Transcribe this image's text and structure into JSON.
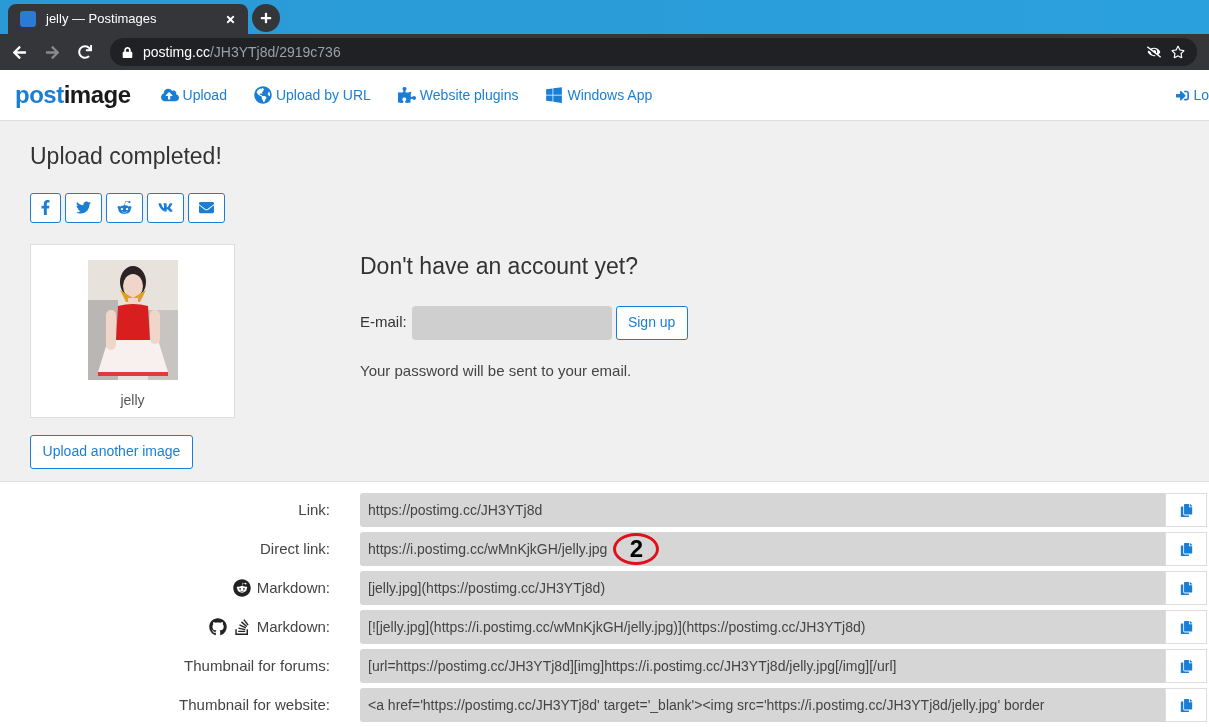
{
  "browser": {
    "tab": {
      "title": "jelly — Postimages"
    },
    "address": {
      "host": "postimg.cc",
      "path": "/JH3YTj8d/2919c736"
    }
  },
  "nav": {
    "logo": "postimage",
    "items": [
      {
        "kind": "upload",
        "label": "Upload"
      },
      {
        "kind": "url",
        "label": "Upload by URL"
      },
      {
        "kind": "plugins",
        "label": "Website plugins"
      },
      {
        "kind": "windows",
        "label": "Windows App"
      }
    ],
    "login": "Lo"
  },
  "upload": {
    "title": "Upload completed!",
    "share": [
      {
        "kind": "facebook"
      },
      {
        "kind": "twitter"
      },
      {
        "kind": "reddit"
      },
      {
        "kind": "vk"
      },
      {
        "kind": "email"
      }
    ],
    "thumbnail": {
      "kind": "picture",
      "caption": "jelly"
    },
    "another": "Upload another image"
  },
  "signup": {
    "title": "Don't have an account yet?",
    "email_label": "E-mail:",
    "button": "Sign up",
    "note": "Your password will be sent to your email."
  },
  "links": [
    {
      "label": "Link:",
      "value": "https://postimg.cc/JH3YTj8d"
    },
    {
      "label": "Direct link:",
      "value": "https://i.postimg.cc/wMnKjkGH/jelly.jpg",
      "annotation": "2"
    },
    {
      "label": "Markdown:",
      "icons": [
        {
          "kind": "reddit"
        }
      ],
      "value": "[jelly.jpg](https://postimg.cc/JH3YTj8d)"
    },
    {
      "label": "Markdown:",
      "icons": [
        {
          "kind": "github"
        },
        {
          "kind": "stack"
        }
      ],
      "value": "[![jelly.jpg](https://i.postimg.cc/wMnKjkGH/jelly.jpg)](https://postimg.cc/JH3YTj8d)"
    },
    {
      "label": "Thumbnail for forums:",
      "value": "[url=https://postimg.cc/JH3YTj8d][img]https://i.postimg.cc/JH3YTj8d/jelly.jpg[/img][/url]"
    },
    {
      "label": "Thumbnail for website:",
      "value": "<a href='https://postimg.cc/JH3YTj8d' target='_blank'><img src='https://i.postimg.cc/JH3YTj8d/jelly.jpg' border"
    }
  ]
}
